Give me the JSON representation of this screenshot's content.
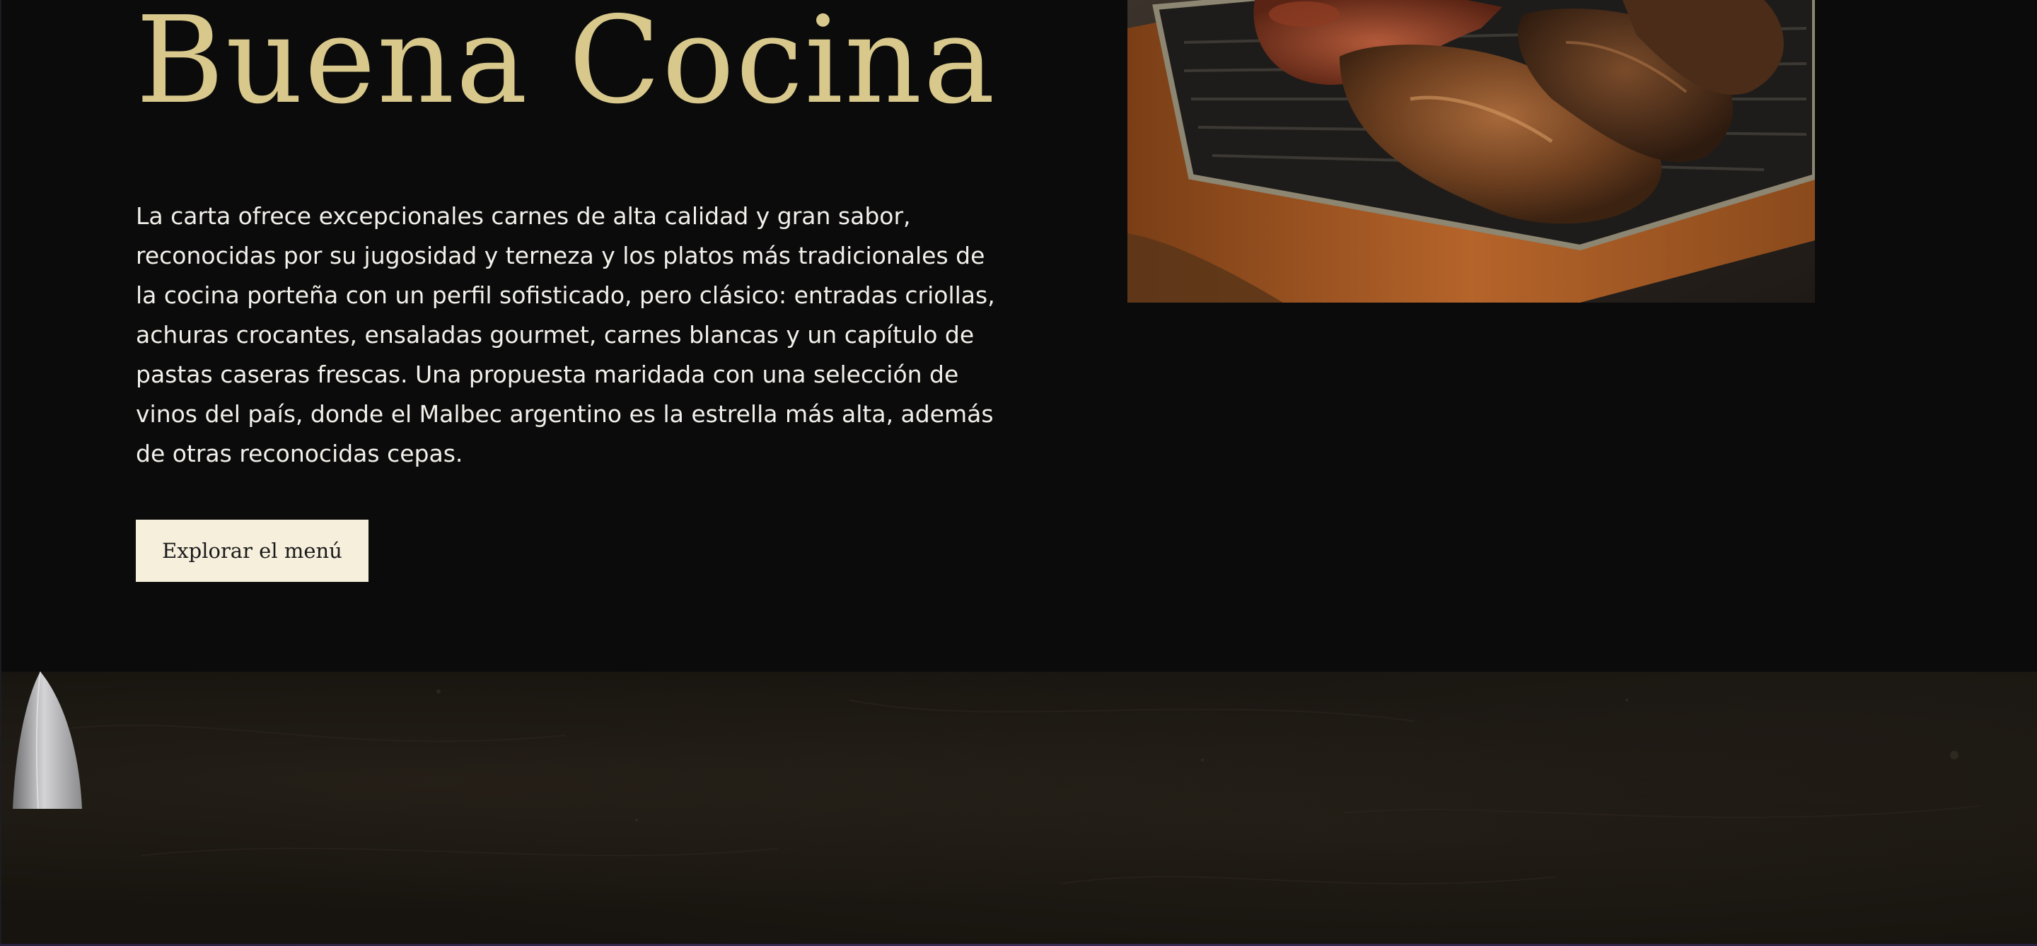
{
  "hero": {
    "title": "Buena Cocina",
    "description": "La carta ofrece excepcionales carnes de alta calidad y gran sabor, reconocidas por su jugosidad y terneza y los platos más tradicionales de la cocina porteña con un perfil sofisticado, pero clásico: entradas criollas, achuras crocantes, ensaladas gourmet, carnes blancas y un capítulo de pastas caseras frescas. Una propuesta maridada con una selección de vinos del país, donde el Malbec argentino es la estrella más alta, además de otras reconocidas cepas.",
    "cta_label": "Explorar el menú"
  },
  "images": {
    "food_photo": "grilled-meats-on-tray",
    "texture_background": "dark-slate-with-knife"
  },
  "colors": {
    "background": "#0b0b0b",
    "title_gold": "#d8c88c",
    "text": "#f2f0ea",
    "button_bg": "#f6efdc",
    "button_text": "#1a1a1a"
  }
}
